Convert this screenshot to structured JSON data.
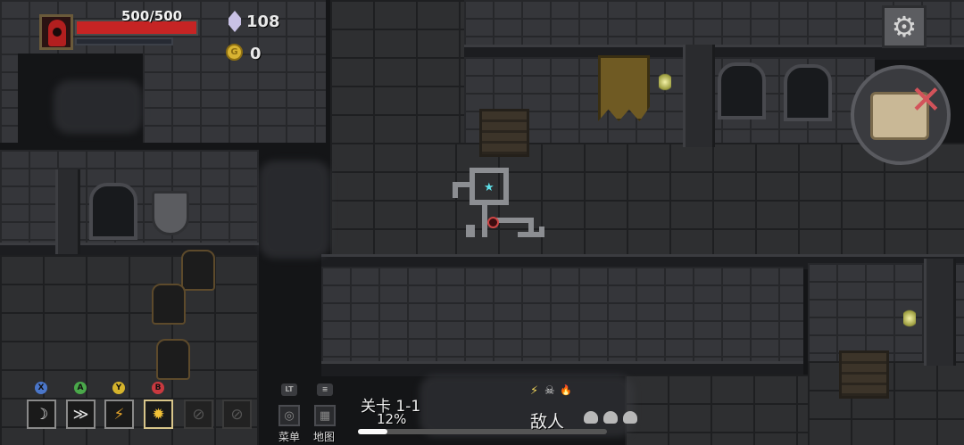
{
  "player": {
    "hp_text": "500/500",
    "hp_fraction": 1.0,
    "mp_fraction": 0.0,
    "portrait_icon": "red-hooded-wizard-icon"
  },
  "currency": {
    "gems": "108",
    "gem_icon": "purple-gem-icon",
    "gold": "0",
    "coin_icon": "gold-coin-icon",
    "coin_glyph": "G"
  },
  "settings": {
    "icon": "gear-icon",
    "glyph": "⚙"
  },
  "map_button": {
    "icon": "map-scroll-closed-icon",
    "glyph": "✕"
  },
  "skills": [
    {
      "button": "X",
      "button_color": "#4a76c9",
      "icon": "crescent-slash-icon",
      "glyph": "☽",
      "state": "ready"
    },
    {
      "button": "A",
      "button_color": "#4aa84a",
      "icon": "wind-dash-icon",
      "glyph": "≫",
      "state": "ready"
    },
    {
      "button": "Y",
      "button_color": "#d6b42c",
      "icon": "fire-swirl-icon",
      "glyph": "⚡",
      "state": "ready"
    },
    {
      "button": "B",
      "button_color": "#c9393f",
      "icon": "fireball-icon",
      "glyph": "✹",
      "state": "active"
    },
    {
      "button": "",
      "button_color": "",
      "icon": "empty-slot-icon",
      "glyph": "⊘",
      "state": "locked"
    },
    {
      "button": "",
      "button_color": "",
      "icon": "empty-slot-icon",
      "glyph": "⊘",
      "state": "locked"
    }
  ],
  "menu": {
    "label": "菜单",
    "badge": "LT",
    "icon": "menu-icon"
  },
  "map": {
    "label": "地图",
    "badge": "≡",
    "icon": "map-icon"
  },
  "level": {
    "name": "关卡 1-1",
    "progress_text": "12%",
    "progress_fraction": 0.12
  },
  "enemies": {
    "label": "敌人",
    "effects": [
      {
        "icon": "lightning-icon",
        "glyph": "⚡",
        "color": "#f0d45a"
      },
      {
        "icon": "frost-skull-icon",
        "glyph": "☠",
        "color": "#d8d8d8"
      },
      {
        "icon": "flame-icon",
        "glyph": "🔥",
        "color": "#f09a2a"
      }
    ],
    "remaining_icons": [
      "skull-icon",
      "skull-icon",
      "skull-icon"
    ]
  },
  "minimap": {
    "current_room_icon": "star-icon",
    "star_glyph": "★",
    "player_icon": "player-marker-icon"
  },
  "colors": {
    "hp": "#c62424",
    "accent_gold": "#d8b332",
    "background": "#242527"
  }
}
